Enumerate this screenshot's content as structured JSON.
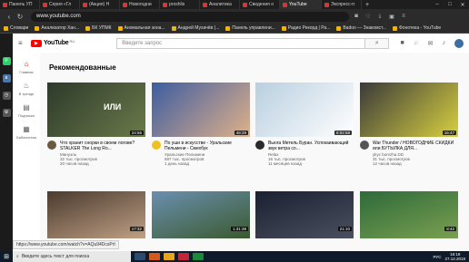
{
  "browser": {
    "tabs": [
      {
        "label": "Панель УП"
      },
      {
        "label": "Серия «Гл"
      },
      {
        "label": "(Акция) Н"
      },
      {
        "label": "Новогодни"
      },
      {
        "label": "proshlis"
      },
      {
        "label": "Аналитика"
      },
      {
        "label": "Сведения о"
      },
      {
        "label": "YouTube"
      },
      {
        "label": "Экспресс-п"
      }
    ],
    "active_tab": 7,
    "url": "www.youtube.com",
    "bookmarks": [
      {
        "label": "Словари"
      },
      {
        "label": "Анализатор Хан..."
      },
      {
        "label": "БК УПМК"
      },
      {
        "label": "Аномальная зона..."
      },
      {
        "label": "Андрей Мухачёв (..."
      },
      {
        "label": "Панель управлени..."
      },
      {
        "label": "Радио Рекорд | Ра..."
      },
      {
        "label": "Badoo — Знакомст..."
      },
      {
        "label": "Фонотека - YouTube"
      }
    ]
  },
  "yt": {
    "logo_text": "YouTube",
    "logo_region": "RU",
    "search_placeholder": "Введите запрос",
    "sidebar": [
      {
        "label": "Главная",
        "icon": "home-icon"
      },
      {
        "label": "В тренде",
        "icon": "flame-icon"
      },
      {
        "label": "Подписки",
        "icon": "subscriptions-icon"
      },
      {
        "label": "Библиотека",
        "icon": "library-icon"
      }
    ],
    "section_title": "Рекомендованные",
    "videos": [
      {
        "title": "Что хранит снорки в своем логове? STALKER The Long Ro...",
        "channel": "Мануэль",
        "views": "32 тыс. просмотров",
        "age": "20 часов назад",
        "duration": "24:56",
        "thumb_text": "ИЛИ",
        "colors": [
          "#2c3a2a",
          "#6b7a4a"
        ]
      },
      {
        "title": "По уши в искусстве - Уральские Пельмени - Смехбук",
        "channel": "Уральские Пельмени",
        "views": "697 тыс. просмотров",
        "age": "1 день назад",
        "duration": "48:29",
        "thumb_text": "",
        "colors": [
          "#3d5da0",
          "#e0b08a"
        ]
      },
      {
        "title": "Вьюга Метель Буран. Успокаивающий звук ветра со...",
        "channel": "Relax",
        "views": "16 тыс. просмотров",
        "age": "11 месяцев назад",
        "duration": "8:02:58",
        "thumb_text": "",
        "colors": [
          "#b9cfe0",
          "#ffffff"
        ]
      },
      {
        "title": "War Thunder / НОВОГОДНИЕ СКИДКИ или БУТЫЛКА ДЛЯ...",
        "channel": "ykyc bomzha DD",
        "views": "31 тыс. просмотров",
        "age": "12 часов назад",
        "duration": "16:47",
        "thumb_text": "",
        "colors": [
          "#3a3a3a",
          "#d8d040"
        ]
      }
    ],
    "row2": [
      {
        "duration": "17:32",
        "colors": [
          "#4a3a2e",
          "#bfa084"
        ]
      },
      {
        "duration": "1:31:38",
        "colors": [
          "#6a8fb0",
          "#3a5a2e"
        ]
      },
      {
        "duration": "21:10",
        "colors": [
          "#1a2030",
          "#4a5060"
        ]
      },
      {
        "duration": "8:42",
        "colors": [
          "#2e6a3a",
          "#7aa050"
        ]
      }
    ]
  },
  "status_url": "https://www.youtube.com/watch?v=AQu94DcsPrI",
  "taskbar": {
    "search_text": "Введите здесь текст для поиска",
    "lang": "РУС",
    "time": "16:18",
    "date": "27.12.2019"
  }
}
